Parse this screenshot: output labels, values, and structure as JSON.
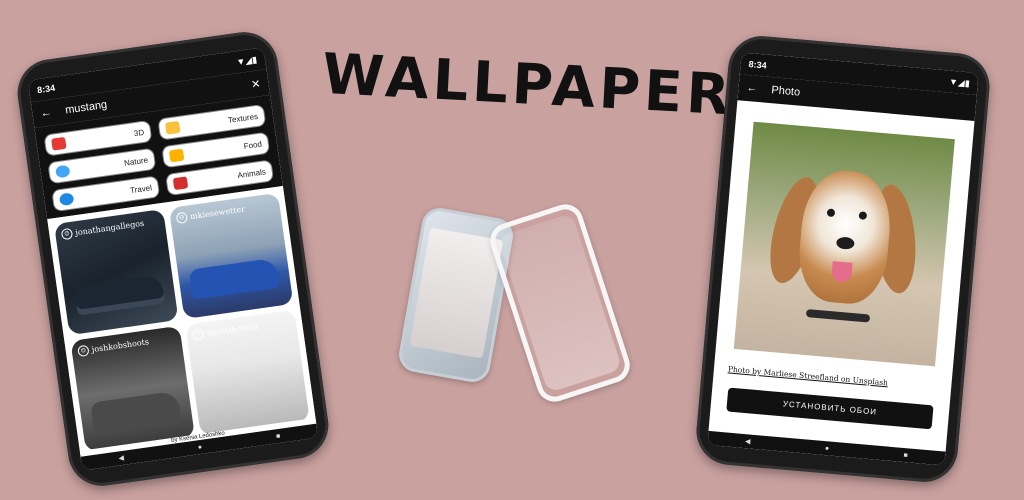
{
  "headline": "WALLPAPER",
  "left_phone": {
    "status_time": "8:34",
    "search_value": "mustang",
    "categories": [
      {
        "label": "3D",
        "icon_color": "#e53935"
      },
      {
        "label": "Textures",
        "icon_color": "#f9c23c"
      },
      {
        "label": "Nature",
        "icon_color": "#42a5f5"
      },
      {
        "label": "Food",
        "icon_color": "#ffb300"
      },
      {
        "label": "Travel",
        "icon_color": "#1e88e5"
      },
      {
        "label": "Animals",
        "icon_color": "#d32f2f"
      }
    ],
    "photos": [
      {
        "user": "jonathangallegos"
      },
      {
        "user": "mkiesewetter"
      },
      {
        "user": "joshkobshoots"
      },
      {
        "user": "meritthomas"
      }
    ],
    "credit": "by Ksenia Ledoshko"
  },
  "right_phone": {
    "status_time": "8:34",
    "title": "Photo",
    "caption": "Photo by Marliese Streefland on Unsplash",
    "button_label": "УСТАНОВИТЬ ОБОИ"
  }
}
